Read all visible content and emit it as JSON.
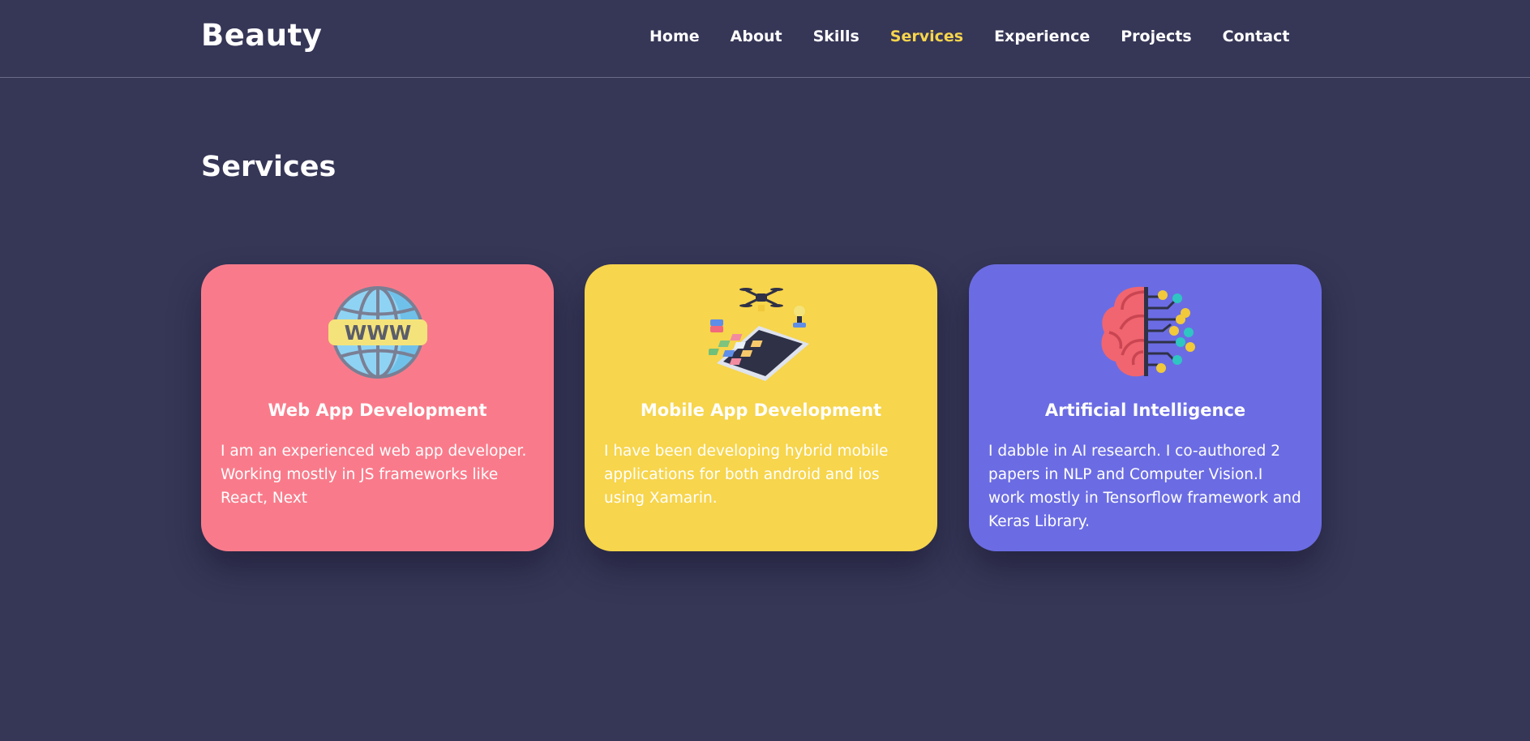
{
  "brand": "Beauty",
  "nav": {
    "home": "Home",
    "about": "About",
    "skills": "Skills",
    "services": "Services",
    "experience": "Experience",
    "projects": "Projects",
    "contact": "Contact"
  },
  "colors": {
    "background": "#363657",
    "accent": "#f7d54c",
    "card_web": "#f97b8b",
    "card_mobile": "#f7d54c",
    "card_ai": "#6b6ce3"
  },
  "section_title": "Services",
  "cards": [
    {
      "icon": "globe-www-icon",
      "title": "Web App Development",
      "desc": "I am an experienced web app developer. Working mostly in JS frameworks like React, Next"
    },
    {
      "icon": "mobile-app-icon",
      "title": "Mobile App Development",
      "desc": "I have been developing hybrid mobile applications for both android and ios using Xamarin."
    },
    {
      "icon": "brain-circuit-icon",
      "title": "Artificial Intelligence",
      "desc": "I dabble in AI research. I co-authored 2 papers in NLP and Computer Vision.I work mostly in Tensorflow framework and Keras Library."
    }
  ]
}
